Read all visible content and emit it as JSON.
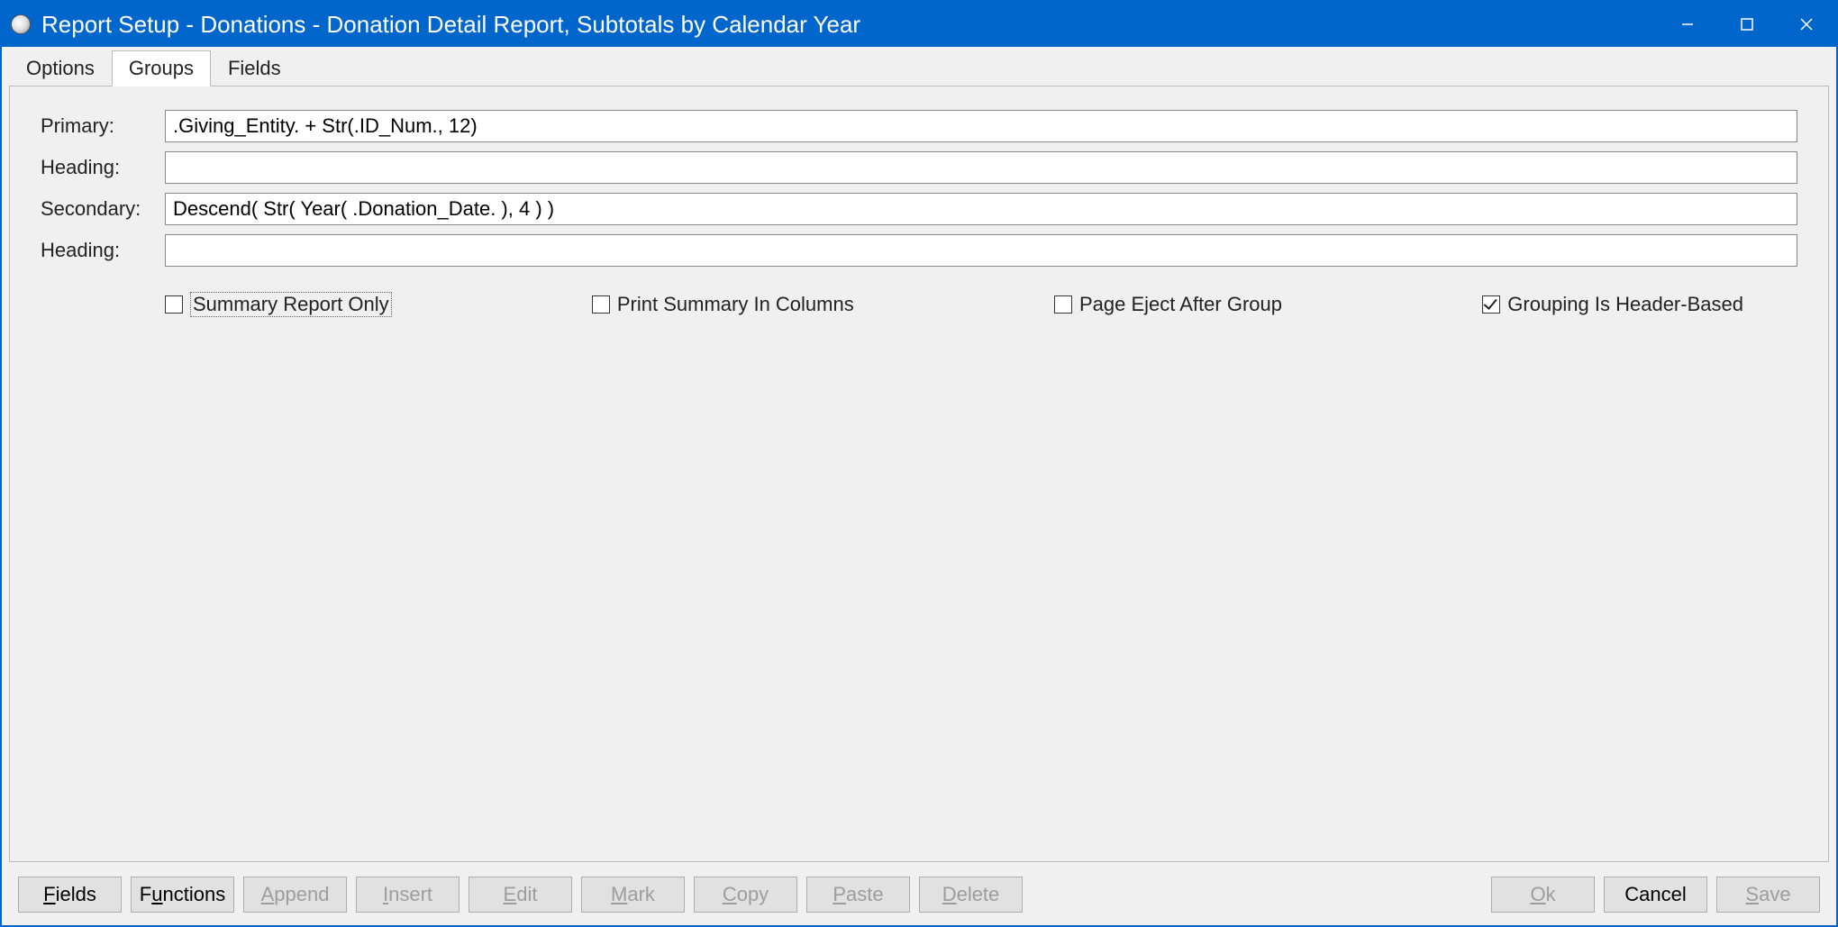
{
  "window": {
    "title": "Report Setup - Donations - Donation Detail Report, Subtotals by Calendar Year"
  },
  "tabs": {
    "options": "Options",
    "groups": "Groups",
    "fields": "Fields",
    "active": "groups"
  },
  "form": {
    "primary_label": "Primary:",
    "primary_value": ".Giving_Entity. + Str(.ID_Num., 12)",
    "heading1_label": "Heading:",
    "heading1_value": "",
    "secondary_label": "Secondary:",
    "secondary_value": "Descend( Str( Year( .Donation_Date. ), 4 ) )",
    "heading2_label": "Heading:",
    "heading2_value": ""
  },
  "checkboxes": {
    "summary_only": {
      "label": "Summary Report Only",
      "checked": false
    },
    "print_columns": {
      "label": "Print Summary In Columns",
      "checked": false
    },
    "page_eject": {
      "label": "Page Eject After Group",
      "checked": false
    },
    "header_based": {
      "label": "Grouping Is Header-Based",
      "checked": true
    }
  },
  "buttons": {
    "fields": "Fields",
    "functions": "Functions",
    "append": "Append",
    "insert": "Insert",
    "edit": "Edit",
    "mark": "Mark",
    "copy": "Copy",
    "paste": "Paste",
    "delete": "Delete",
    "ok": "Ok",
    "cancel": "Cancel",
    "save": "Save"
  }
}
